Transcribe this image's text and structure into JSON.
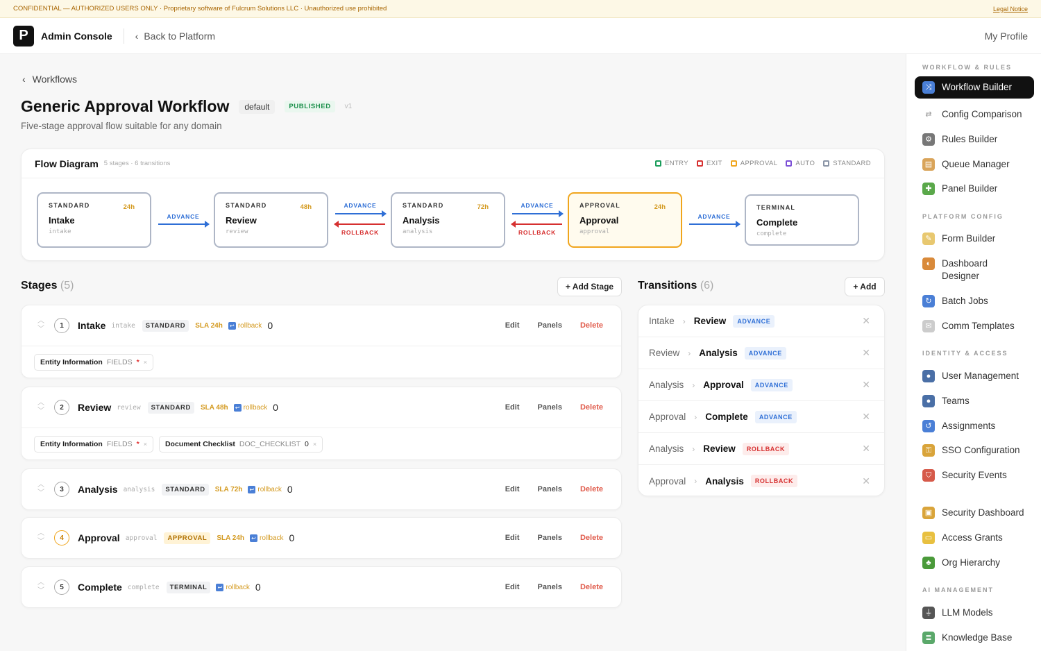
{
  "banner": {
    "text": "CONFIDENTIAL — AUTHORIZED USERS ONLY · Proprietary software of Fulcrum Solutions LLC · Unauthorized use prohibited",
    "link": "Legal Notice"
  },
  "topbar": {
    "logo": "P",
    "app_name": "Admin Console",
    "back_label": "Back to Platform",
    "profile": "My Profile"
  },
  "page": {
    "breadcrumb": "Workflows",
    "title": "Generic Approval Workflow",
    "tag_default": "default",
    "tag_status": "PUBLISHED",
    "version": "v1",
    "subtitle": "Five-stage approval flow suitable for any domain"
  },
  "flow": {
    "title": "Flow Diagram",
    "meta": "5 stages · 6 transitions",
    "legend": [
      {
        "label": "ENTRY",
        "color": "#1a9c5a"
      },
      {
        "label": "EXIT",
        "color": "#d63030"
      },
      {
        "label": "APPROVAL",
        "color": "#f0a51c"
      },
      {
        "label": "AUTO",
        "color": "#7b4fd6"
      },
      {
        "label": "STANDARD",
        "color": "#8a94a6"
      }
    ],
    "stages": [
      {
        "type": "STANDARD",
        "sla": "24h",
        "name": "Intake",
        "key": "intake"
      },
      {
        "type": "STANDARD",
        "sla": "48h",
        "name": "Review",
        "key": "review"
      },
      {
        "type": "STANDARD",
        "sla": "72h",
        "name": "Analysis",
        "key": "analysis"
      },
      {
        "type": "APPROVAL",
        "sla": "24h",
        "name": "Approval",
        "key": "approval"
      },
      {
        "type": "TERMINAL",
        "sla": "",
        "name": "Complete",
        "key": "complete"
      }
    ],
    "connectors": [
      {
        "advance": "ADVANCE",
        "rollback": ""
      },
      {
        "advance": "ADVANCE",
        "rollback": "ROLLBACK"
      },
      {
        "advance": "ADVANCE",
        "rollback": "ROLLBACK"
      },
      {
        "advance": "ADVANCE",
        "rollback": ""
      }
    ]
  },
  "stages_section": {
    "title": "Stages",
    "count": "(5)",
    "add_label": "+ Add Stage"
  },
  "stage_rows": [
    {
      "num": "1",
      "name": "Intake",
      "key": "intake",
      "type": "STANDARD",
      "sla": "SLA 24h",
      "rollback": "rollback",
      "zero": "0",
      "panels": [
        {
          "name": "Entity Information",
          "type": "FIELDS",
          "star": "*",
          "x": "×"
        }
      ]
    },
    {
      "num": "2",
      "name": "Review",
      "key": "review",
      "type": "STANDARD",
      "sla": "SLA 48h",
      "rollback": "rollback",
      "zero": "0",
      "panels": [
        {
          "name": "Entity Information",
          "type": "FIELDS",
          "star": "*",
          "x": "×"
        },
        {
          "name": "Document Checklist",
          "type": "DOC_CHECKLIST",
          "star": "0",
          "x": "×"
        }
      ]
    },
    {
      "num": "3",
      "name": "Analysis",
      "key": "analysis",
      "type": "STANDARD",
      "sla": "SLA 72h",
      "rollback": "rollback",
      "zero": "0",
      "panels": []
    },
    {
      "num": "4",
      "name": "Approval",
      "key": "approval",
      "type": "APPROVAL",
      "sla": "SLA 24h",
      "rollback": "rollback",
      "zero": "0",
      "panels": []
    },
    {
      "num": "5",
      "name": "Complete",
      "key": "complete",
      "type": "TERMINAL",
      "sla": "",
      "rollback": "rollback",
      "zero": "0",
      "panels": []
    }
  ],
  "stage_actions": {
    "edit": "Edit",
    "panels": "Panels",
    "delete": "Delete"
  },
  "transitions_section": {
    "title": "Transitions",
    "count": "(6)",
    "add_label": "+ Add"
  },
  "transitions": [
    {
      "from": "Intake",
      "to": "Review",
      "type": "ADVANCE"
    },
    {
      "from": "Review",
      "to": "Analysis",
      "type": "ADVANCE"
    },
    {
      "from": "Analysis",
      "to": "Approval",
      "type": "ADVANCE"
    },
    {
      "from": "Approval",
      "to": "Complete",
      "type": "ADVANCE"
    },
    {
      "from": "Analysis",
      "to": "Review",
      "type": "ROLLBACK"
    },
    {
      "from": "Approval",
      "to": "Analysis",
      "type": "ROLLBACK"
    }
  ],
  "sidebar": [
    {
      "group": "WORKFLOW & RULES",
      "items": [
        {
          "label": "Workflow Builder",
          "icon": "shuffle-icon",
          "color": "#4a7fd6",
          "glyph": "⤨",
          "active": true
        },
        {
          "label": "Config Comparison",
          "icon": "swap-icon",
          "color": "#ffffff",
          "glyph": "⇄"
        },
        {
          "label": "Rules Builder",
          "icon": "gear-icon",
          "color": "#777777",
          "glyph": "⚙"
        },
        {
          "label": "Queue Manager",
          "icon": "folder-icon",
          "color": "#d9a45a",
          "glyph": "▤"
        },
        {
          "label": "Panel Builder",
          "icon": "puzzle-icon",
          "color": "#5aa84a",
          "glyph": "✚"
        }
      ]
    },
    {
      "group": "PLATFORM CONFIG",
      "items": [
        {
          "label": "Form Builder",
          "icon": "memo-icon",
          "color": "#e8c870",
          "glyph": "✎"
        },
        {
          "label": "Dashboard Designer",
          "icon": "palette-icon",
          "color": "#d98a3a",
          "glyph": "◐"
        },
        {
          "label": "Batch Jobs",
          "icon": "repeat-icon",
          "color": "#4a7fd6",
          "glyph": "↻"
        },
        {
          "label": "Comm Templates",
          "icon": "envelope-icon",
          "color": "#cccccc",
          "glyph": "✉"
        }
      ]
    },
    {
      "group": "IDENTITY & ACCESS",
      "items": [
        {
          "label": "User Management",
          "icon": "user-icon",
          "color": "#4a6fa6",
          "glyph": "●"
        },
        {
          "label": "Teams",
          "icon": "users-icon",
          "color": "#4a6fa6",
          "glyph": "●"
        },
        {
          "label": "Assignments",
          "icon": "cycle-icon",
          "color": "#4a7fd6",
          "glyph": "↺"
        },
        {
          "label": "SSO Configuration",
          "icon": "lock-key-icon",
          "color": "#d9a43a",
          "glyph": "⚿"
        },
        {
          "label": "Security Events",
          "icon": "shield-icon",
          "color": "#d65a4a",
          "glyph": "⛉"
        },
        {
          "label": "Security Dashboard",
          "icon": "lock-icon",
          "color": "#d9a43a",
          "glyph": "▣"
        },
        {
          "label": "Access Grants",
          "icon": "id-card-icon",
          "color": "#e8c040",
          "glyph": "▭"
        },
        {
          "label": "Org Hierarchy",
          "icon": "tree-icon",
          "color": "#4a9a3a",
          "glyph": "♣"
        }
      ]
    },
    {
      "group": "AI MANAGEMENT",
      "items": [
        {
          "label": "LLM Models",
          "icon": "plug-icon",
          "color": "#555555",
          "glyph": "⏚"
        },
        {
          "label": "Knowledge Base",
          "icon": "books-icon",
          "color": "#5aa86a",
          "glyph": "≣"
        }
      ]
    }
  ]
}
